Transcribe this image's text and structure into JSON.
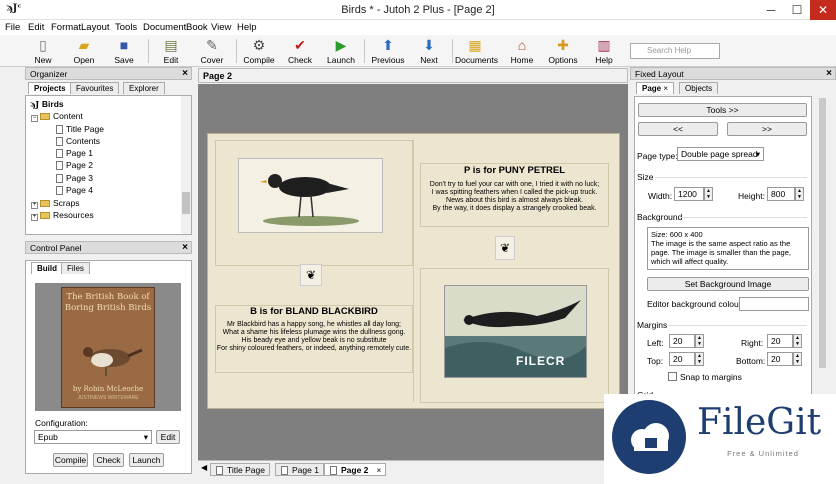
{
  "window": {
    "app_glyph": "ϡJᶜ",
    "title": "Birds * - Jutoh 2 Plus - [Page 2]",
    "min": "─",
    "max": "☐",
    "close": "✕"
  },
  "menu": [
    "File",
    "Edit",
    "Format",
    "Layout",
    "Tools",
    "Document",
    "Book",
    "View",
    "Help"
  ],
  "toolbar": {
    "new": "New",
    "open": "Open",
    "save": "Save",
    "edit": "Edit",
    "cover": "Cover",
    "compile": "Compile",
    "check": "Check",
    "launch": "Launch",
    "previous": "Previous",
    "next": "Next",
    "documents": "Documents",
    "home": "Home",
    "options": "Options",
    "help": "Help",
    "search_placeholder": "Search Help"
  },
  "organizer": {
    "title": "Organizer",
    "tabs": [
      "Projects",
      "Favourites",
      "Explorer"
    ],
    "tree": {
      "root": "Birds",
      "content": "Content",
      "items": [
        "Title Page",
        "Contents",
        "Page 1",
        "Page 2",
        "Page 3",
        "Page 4"
      ],
      "scraps": "Scraps",
      "resources": "Resources"
    }
  },
  "control_panel": {
    "title": "Control Panel",
    "tabs": [
      "Build",
      "Files"
    ],
    "cover": {
      "title": "The British Book of Boring British Birds",
      "author": "by Robin McLeoche",
      "subtitle": "JUSTINEWS WRITEWARE"
    },
    "configuration_label": "Configuration:",
    "configuration_value": "Epub",
    "edit": "Edit",
    "compile": "Compile",
    "check": "Check",
    "launch": "Launch"
  },
  "document": {
    "header": "Page 2",
    "left_page": {
      "heading": "B is for BLAND BLACKBIRD",
      "text": "Mr Blackbird has a happy song, he whistles all day long;\nWhat a shame his lifeless plumage wins the dullness gong.\nHis beady eye and yellow beak is no substitute\nFor shiny coloured feathers, or indeed, anything remotely cute."
    },
    "right_page": {
      "heading": "P is for PUNY PETREL",
      "text": "Don't try to fuel your car with one, I tried it with no luck;\nI was spitting feathers when I called the pick-up truck.\nNews about this bird is almost always bleak.\nBy the way, it does display a strangely crooked beak."
    },
    "watermark": "FILECR",
    "page_tabs": [
      "Title Page",
      "Page 1",
      "Page 2"
    ]
  },
  "fixed_layout": {
    "title": "Fixed Layout",
    "tabs": [
      "Page",
      "Objects"
    ],
    "tools": "Tools >>",
    "prev": "<<",
    "next": ">>",
    "page_type_label": "Page type:",
    "page_type_value": "Double page spread",
    "size_label": "Size",
    "width_label": "Width:",
    "width_value": "1200",
    "height_label": "Height:",
    "height_value": "800",
    "background_label": "Background",
    "bg_desc": "Size: 600 x 400\nThe image is the same aspect ratio as the page. The image is smaller than the page, which will affect quality.",
    "set_bg": "Set Background Image",
    "editor_bg_label": "Editor background colour:",
    "margins_label": "Margins",
    "left_label": "Left:",
    "left_value": "20",
    "right_label": "Right:",
    "right_value": "20",
    "top_label": "Top:",
    "top_value": "20",
    "bottom_label": "Bottom:",
    "bottom_value": "20",
    "snap_label": "Snap to margins",
    "grid_label": "Grid"
  },
  "filegit": {
    "name": "FileGit",
    "sub": "Free & Unlimited"
  }
}
